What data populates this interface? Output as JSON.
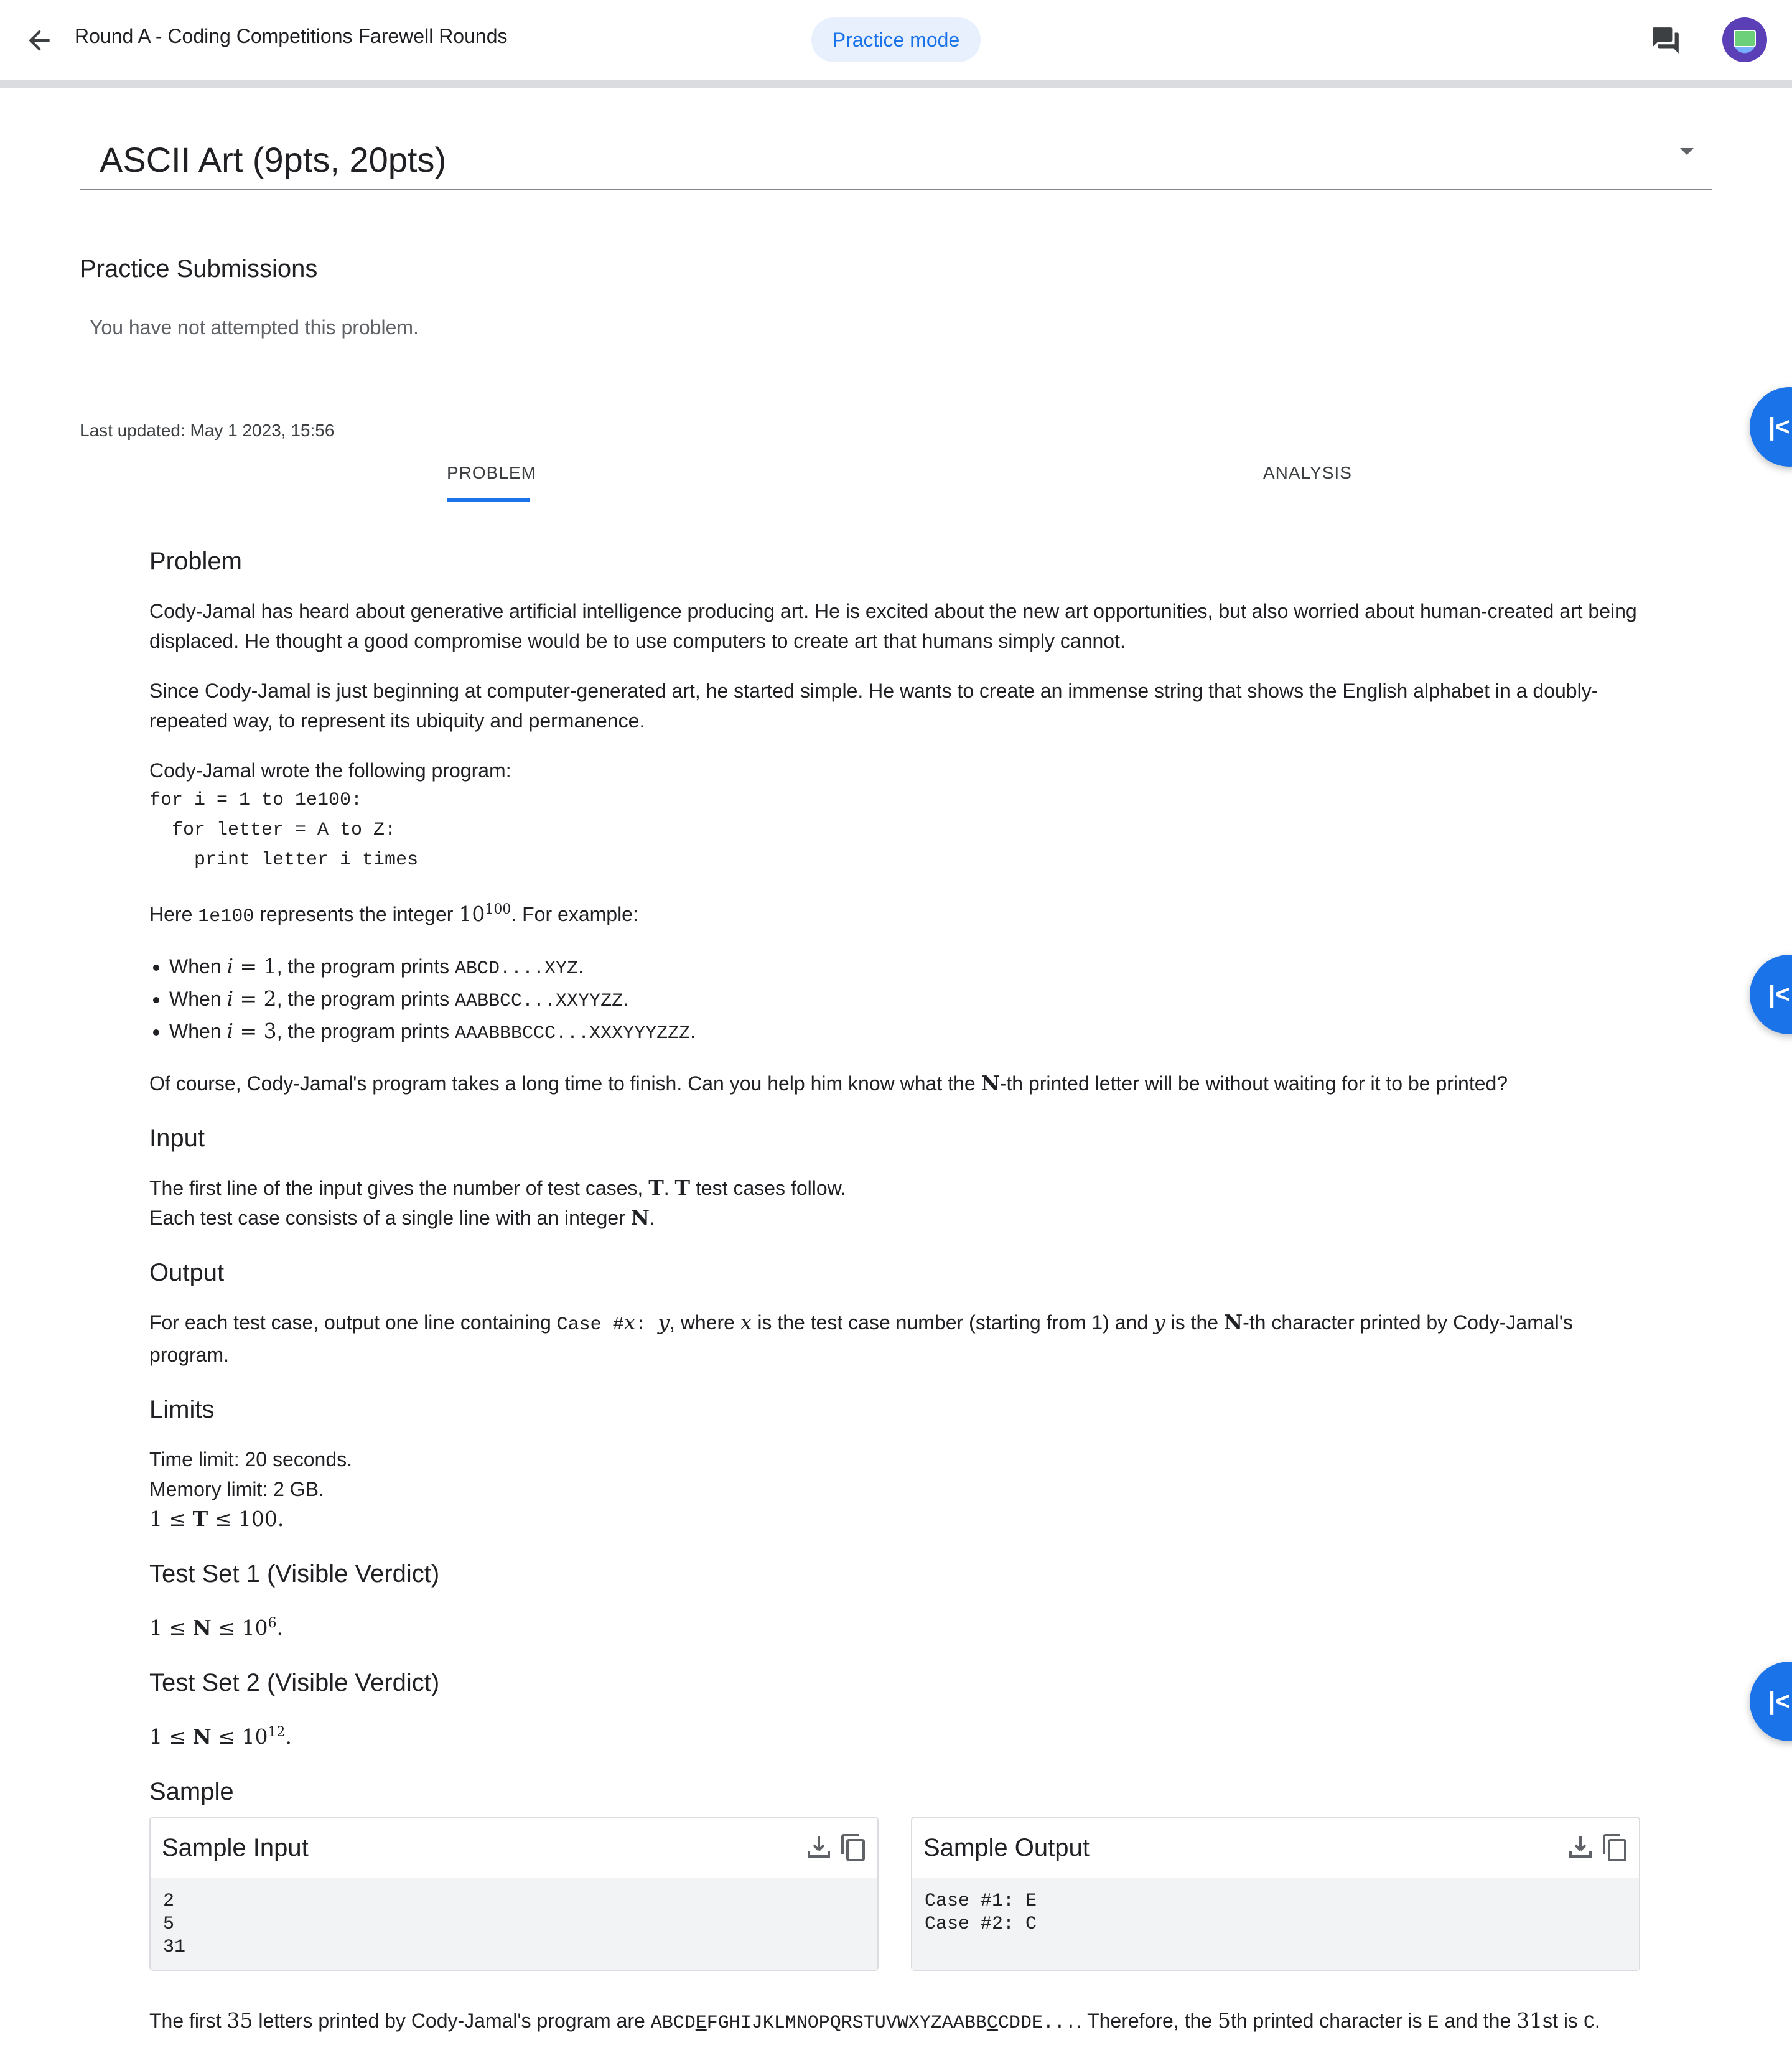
{
  "header": {
    "round_title": "Round A - Coding Competitions Farewell Rounds",
    "mode_badge": "Practice mode"
  },
  "problem_selector": {
    "selected": "ASCII Art (9pts, 20pts)"
  },
  "submissions": {
    "heading": "Practice Submissions",
    "empty_text": "You have not attempted this problem."
  },
  "last_updated": "Last updated: May 1 2023, 15:56",
  "tabs": [
    {
      "label": "PROBLEM",
      "active": true
    },
    {
      "label": "ANALYSIS",
      "active": false
    }
  ],
  "problem": {
    "h_problem": "Problem",
    "p1": "Cody-Jamal has heard about generative artificial intelligence producing art. He is excited about the new art opportunities, but also worried about human-created art being displaced. He thought a good compromise would be to use computers to create art that humans simply cannot.",
    "p2": "Since Cody-Jamal is just beginning at computer-generated art, he started simple. He wants to create an immense string that shows the English alphabet in a doubly-repeated way, to represent its ubiquity and permanence.",
    "p3": "Cody-Jamal wrote the following program:",
    "code": "for i = 1 to 1e100:\n  for letter = A to Z:\n    print letter i times",
    "here_prefix": "Here ",
    "here_code": "1e100",
    "here_mid": " represents the integer ",
    "here_base": "10",
    "here_exp": "100",
    "here_suffix": ". For example:",
    "examples": [
      {
        "prefix": "When ",
        "var": "i",
        "eq": " = 1",
        "mid": ", the program prints ",
        "out": "ABCD....XYZ",
        "end": "."
      },
      {
        "prefix": "When ",
        "var": "i",
        "eq": " = 2",
        "mid": ", the program prints ",
        "out": "AABBCC...XXYYZZ",
        "end": "."
      },
      {
        "prefix": "When ",
        "var": "i",
        "eq": " = 3",
        "mid": ", the program prints ",
        "out": "AAABBBCCC...XXXYYYZZZ",
        "end": "."
      }
    ],
    "p4_a": "Of course, Cody-Jamal's program takes a long time to finish. Can you help him know what the ",
    "p4_N": "N",
    "p4_b": "-th printed letter will be without waiting for it to be printed?",
    "h_input": "Input",
    "in1_a": "The first line of the input gives the number of test cases, ",
    "in1_T1": "T",
    "in1_b": ". ",
    "in1_T2": "T",
    "in1_c": " test cases follow.",
    "in2_a": "Each test case consists of a single line with an integer ",
    "in2_N": "N",
    "in2_b": ".",
    "h_output": "Output",
    "out_a": "For each test case, output one line containing ",
    "out_code1": "Case #",
    "out_x": "x",
    "out_code2": ": ",
    "out_y": "y",
    "out_b": ", where ",
    "out_x2": "x",
    "out_c": " is the test case number (starting from 1) and ",
    "out_y2": "y",
    "out_d": " is the ",
    "out_N": "N",
    "out_e": "-th character printed by Cody-Jamal's program.",
    "h_limits": "Limits",
    "lim_time": "Time limit: 20 seconds.",
    "lim_mem": "Memory limit: 2 GB.",
    "lim_T_a": "1 ≤ ",
    "lim_T_T": "T",
    "lim_T_b": " ≤ 100.",
    "h_ts1": "Test Set 1 (Visible Verdict)",
    "ts1_a": "1 ≤ ",
    "ts1_N": "N",
    "ts1_b": " ≤ 10",
    "ts1_exp": "6",
    "ts1_c": ".",
    "h_ts2": "Test Set 2 (Visible Verdict)",
    "ts2_a": "1 ≤ ",
    "ts2_N": "N",
    "ts2_b": " ≤ 10",
    "ts2_exp": "12",
    "ts2_c": ".",
    "h_sample": "Sample"
  },
  "sample": {
    "input_label": "Sample Input",
    "input_text": "2\n5\n31",
    "output_label": "Sample Output",
    "output_text": "Case #1: E\nCase #2: C"
  },
  "note": {
    "a": "The first ",
    "n35": "35",
    "b": " letters printed by Cody-Jamal's program are ",
    "s1": "ABCD",
    "s_u1": "E",
    "s2": "FGHIJKLMNOPQRSTUVWXYZAABB",
    "s_u2": "C",
    "s3": "CDDE...",
    "c": ". Therefore, the ",
    "n5": "5",
    "d": "th printed character is ",
    "e_char": "E",
    "e": " and the ",
    "n31": "31",
    "f": "st is ",
    "c_char": "C",
    "g": "."
  },
  "colors": {
    "accent": "#1a73e8",
    "pill_bg": "#e8f0fe",
    "code_bg": "#f1f3f4"
  },
  "icons": [
    "back-arrow-icon",
    "chat-icon",
    "avatar",
    "collapse-panel-icon",
    "download-icon",
    "copy-icon",
    "dropdown-caret-icon"
  ]
}
